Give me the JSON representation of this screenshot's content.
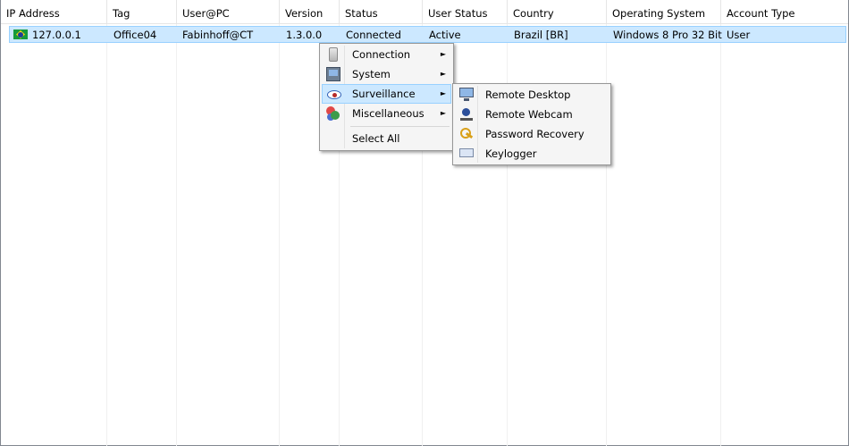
{
  "columns": [
    {
      "label": "IP Address"
    },
    {
      "label": "Tag"
    },
    {
      "label": "User@PC"
    },
    {
      "label": "Version"
    },
    {
      "label": "Status"
    },
    {
      "label": "User Status"
    },
    {
      "label": "Country"
    },
    {
      "label": "Operating System"
    },
    {
      "label": "Account Type"
    }
  ],
  "rows": [
    {
      "flag_icon": "brazil-flag-icon",
      "ip": "127.0.0.1",
      "tag": "Office04",
      "user_pc": "Fabinhoff@CT",
      "version": "1.3.0.0",
      "status": "Connected",
      "user_status": "Active",
      "country": "Brazil [BR]",
      "os": "Windows 8 Pro 32 Bit",
      "account_type": "User"
    }
  ],
  "context_menu": {
    "items": [
      {
        "label": "Connection",
        "icon": "connection-icon",
        "has_submenu": true
      },
      {
        "label": "System",
        "icon": "system-icon",
        "has_submenu": true
      },
      {
        "label": "Surveillance",
        "icon": "eye-icon",
        "has_submenu": true,
        "highlighted": true
      },
      {
        "label": "Miscellaneous",
        "icon": "misc-icon",
        "has_submenu": true
      },
      {
        "label": "Select All",
        "icon": "",
        "has_submenu": false
      }
    ],
    "submenu_arrow": "►"
  },
  "surveillance_submenu": {
    "items": [
      {
        "label": "Remote Desktop",
        "icon": "monitor-icon"
      },
      {
        "label": "Remote Webcam",
        "icon": "webcam-icon"
      },
      {
        "label": "Password Recovery",
        "icon": "key-icon"
      },
      {
        "label": "Keylogger",
        "icon": "keyboard-icon"
      }
    ]
  },
  "colors": {
    "selection": "#cce8ff",
    "selection_border": "#99d1ff",
    "menu_bg": "#f5f5f5"
  }
}
